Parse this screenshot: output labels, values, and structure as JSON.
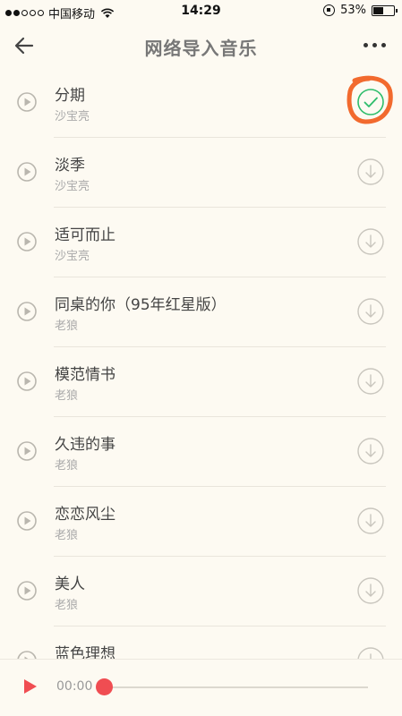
{
  "status_bar": {
    "carrier": "中国移动",
    "time": "14:29",
    "battery": "53%",
    "battery_level": 0.53
  },
  "header": {
    "title": "网络导入音乐"
  },
  "songs": [
    {
      "title": "分期",
      "artist": "沙宝亮",
      "status": "downloaded"
    },
    {
      "title": "淡季",
      "artist": "沙宝亮",
      "status": "download"
    },
    {
      "title": "适可而止",
      "artist": "沙宝亮",
      "status": "download"
    },
    {
      "title": "同桌的你（95年红星版）",
      "artist": "老狼",
      "status": "download"
    },
    {
      "title": "模范情书",
      "artist": "老狼",
      "status": "download"
    },
    {
      "title": "久违的事",
      "artist": "老狼",
      "status": "download"
    },
    {
      "title": "恋恋风尘",
      "artist": "老狼",
      "status": "download"
    },
    {
      "title": "美人",
      "artist": "老狼",
      "status": "download"
    },
    {
      "title": "蓝色理想",
      "artist": "",
      "status": "download"
    }
  ],
  "player": {
    "time": "00:00",
    "progress": 0
  },
  "colors": {
    "accent": "#f04d52",
    "downloaded": "#2ebd6b",
    "annotation": "#f26a2e",
    "background": "#fdfaf2"
  }
}
